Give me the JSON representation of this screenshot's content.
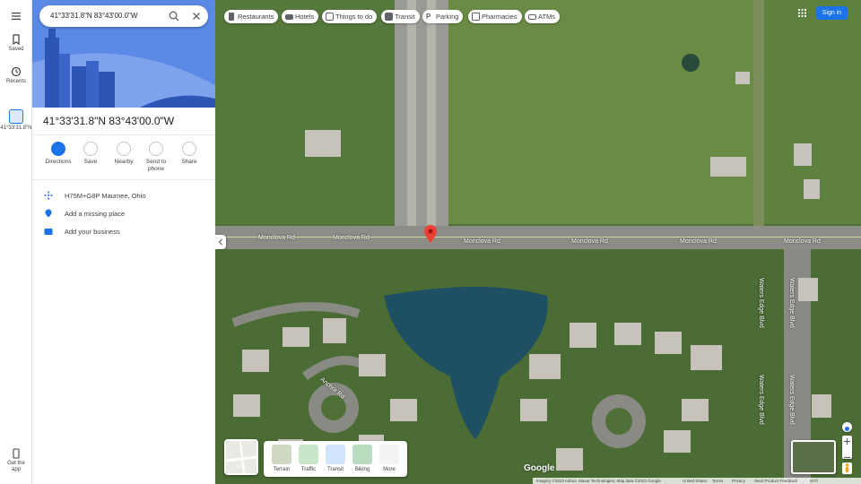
{
  "rail": {
    "menu_icon": "menu-icon",
    "items": [
      {
        "label": "Saved",
        "icon": "bookmark-icon"
      },
      {
        "label": "Recents",
        "icon": "history-icon"
      },
      {
        "label": "41°33'31.8\"N",
        "icon": "place-thumbnail-icon"
      }
    ],
    "get_app": "Get the app"
  },
  "search": {
    "value": "41°33'31.8\"N 83°43'00.0\"W",
    "search_icon": "search-icon",
    "clear_icon": "close-icon"
  },
  "place": {
    "title": "41°33'31.8\"N 83°43'00.0\"W",
    "actions": [
      {
        "label": "Directions",
        "icon": "directions-icon"
      },
      {
        "label": "Save",
        "icon": "bookmark-icon"
      },
      {
        "label": "Nearby",
        "icon": "nearby-icon"
      },
      {
        "label": "Send to phone",
        "icon": "phone-icon"
      },
      {
        "label": "Share",
        "icon": "share-icon"
      }
    ],
    "info": [
      {
        "text": "H75M+G8P Maumee, Ohio",
        "icon": "plus-code-icon"
      },
      {
        "text": "Add a missing place",
        "icon": "add-place-icon"
      },
      {
        "text": "Add your business",
        "icon": "business-icon"
      }
    ]
  },
  "categories": [
    {
      "label": "Restaurants",
      "icon": "restaurant-icon"
    },
    {
      "label": "Hotels",
      "icon": "hotel-icon"
    },
    {
      "label": "Things to do",
      "icon": "camera-icon"
    },
    {
      "label": "Transit",
      "icon": "transit-icon"
    },
    {
      "label": "Parking",
      "icon": "parking-icon"
    },
    {
      "label": "Pharmacies",
      "icon": "pharmacy-icon"
    },
    {
      "label": "ATMs",
      "icon": "atm-icon"
    }
  ],
  "header": {
    "sign_in": "Sign in",
    "apps_icon": "apps-grid-icon"
  },
  "map": {
    "roads": [
      "Monclova Rd",
      "Monclova Rd",
      "Monclova Rd",
      "Monclova Rd",
      "Monclova Rd",
      "Monclova Rd",
      "Waters Edge Blvd",
      "Waters Edge Blvd",
      "Waters Edge Blvd",
      "Waters Edge Blvd",
      "Anchor Rd"
    ],
    "layer_current": "Map",
    "layer_options": [
      "Terrain",
      "Traffic",
      "Transit",
      "Biking",
      "More"
    ],
    "logo": "Google",
    "footer": {
      "imagery": "Imagery ©2023 Airbus, Maxar Technologies, Map data ©2023 Google",
      "country": "United States",
      "terms": "Terms",
      "privacy": "Privacy",
      "feedback": "Send Product Feedback",
      "scale": "50 ft"
    },
    "colors": {
      "pin": "#ea4335",
      "accent": "#1a73e8",
      "pond": "#1e4f63",
      "road": "#8d8d88"
    }
  }
}
